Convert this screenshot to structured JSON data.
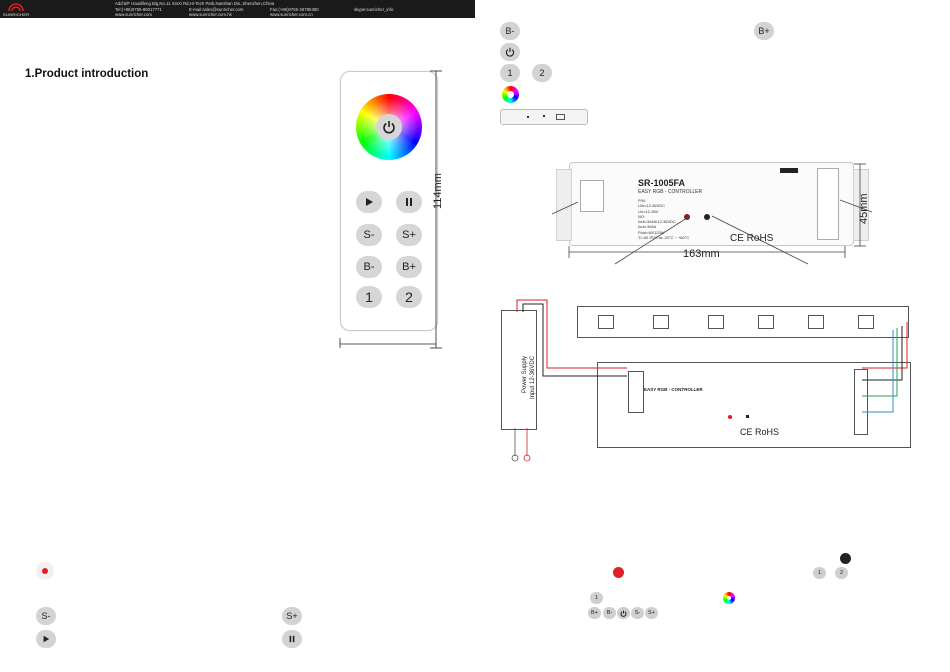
{
  "header": {
    "brand": "SUNRICHER",
    "address": "Add:5/F Haodifeng Blg,No.11 XinXi Rd,Hi-Tech Park,Nanshan Dis.,Shenzhen,China",
    "tel": "Tel:(+86)0755-86017771",
    "email": "E-mail:sales@sunricher.com",
    "fax": "Fax:(+86)0755-26785380",
    "skype": "skype:sunricher_info",
    "web1": "www.sunricher.com",
    "web2": "www.sunricher.com.hk",
    "web3": "www.sunricher.com.cn"
  },
  "section_title": "1.Product introduction",
  "remote": {
    "buttons": [
      "S-",
      "S+",
      "B-",
      "B+",
      "1",
      "2"
    ],
    "height_label": "114mm",
    "width_label": ""
  },
  "right_buttons": {
    "b_minus": "B-",
    "b_plus": "B+",
    "one": "1",
    "two": "2"
  },
  "controller": {
    "model": "SR-1005FA",
    "subtitle": "EASY RGB - CONTROLLER",
    "specs": [
      "P/N:",
      "Uin=12-36VDC",
      "Uo=12-36V",
      "NO:",
      "Iout=3x5A/12-36VDC",
      "Iout=3x5A",
      "Pout=60/120W",
      "TL:60 IP20 ta:-20°C ~ +60°C"
    ],
    "width_label": "163mm",
    "height_label": "45mm",
    "marks": "CE RoHS"
  },
  "wiring": {
    "power_supply": "Power Supply",
    "power_input": "Input 12-36VDC",
    "controller_title": "EASY RGB - CONTROLLER",
    "marks": "CE RoHS"
  },
  "bottom_left": {
    "s_minus": "S-",
    "s_plus": "S+"
  },
  "bottom_right": {
    "one_small": "1",
    "two_small": "2",
    "label_1": "1",
    "small_buttons": [
      "B+",
      "B-",
      "",
      "S-",
      "S+"
    ]
  },
  "colors": {
    "header": "#1a1a1a",
    "button_gray": "#d6d6d6",
    "red": "#e01e24",
    "wire_red": "#d22",
    "wire_green": "#2a9d5a",
    "wire_blue": "#2a8fd6"
  }
}
